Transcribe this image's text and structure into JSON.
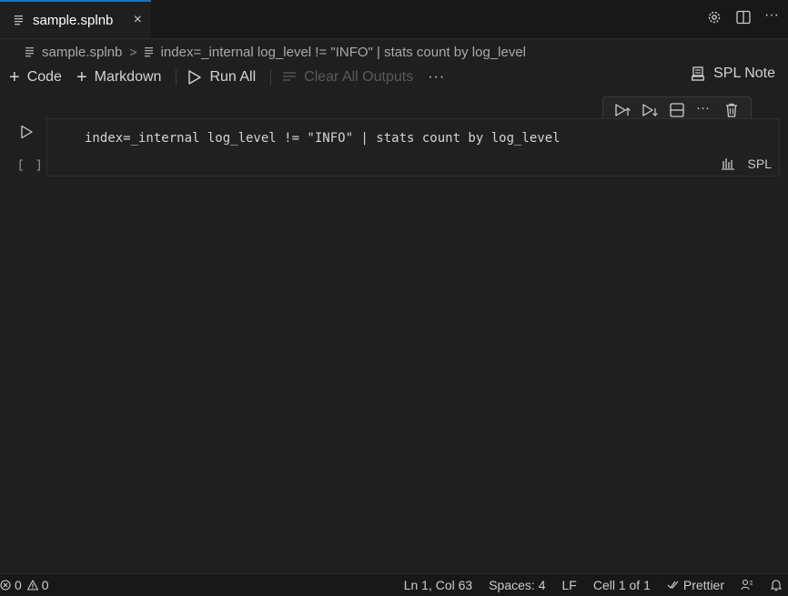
{
  "tab": {
    "title": "sample.splnb",
    "close": "×"
  },
  "breadcrumb": {
    "file": "sample.splnb",
    "separator": ">",
    "cell": "index=_internal log_level != \"INFO\" | stats count by log_level"
  },
  "toolbar": {
    "code_label": "Code",
    "markdown_label": "Markdown",
    "run_all_label": "Run All",
    "clear_outputs_label": "Clear All Outputs",
    "more": "···",
    "kernel_label": "SPL Note"
  },
  "cell": {
    "code": "index=_internal log_level != \"INFO\" | stats count by log_level",
    "execution_count": "[ ]",
    "language": "SPL"
  },
  "statusbar": {
    "errors": "0",
    "warnings": "0",
    "position": "Ln 1, Col 63",
    "spaces": "Spaces: 4",
    "eol": "LF",
    "cell_info": "Cell 1 of 1",
    "formatter": "Prettier"
  },
  "colors": {
    "accent": "#0078d4",
    "background": "#1f1f1f",
    "tabbar": "#181818",
    "statusbar": "#181818"
  }
}
